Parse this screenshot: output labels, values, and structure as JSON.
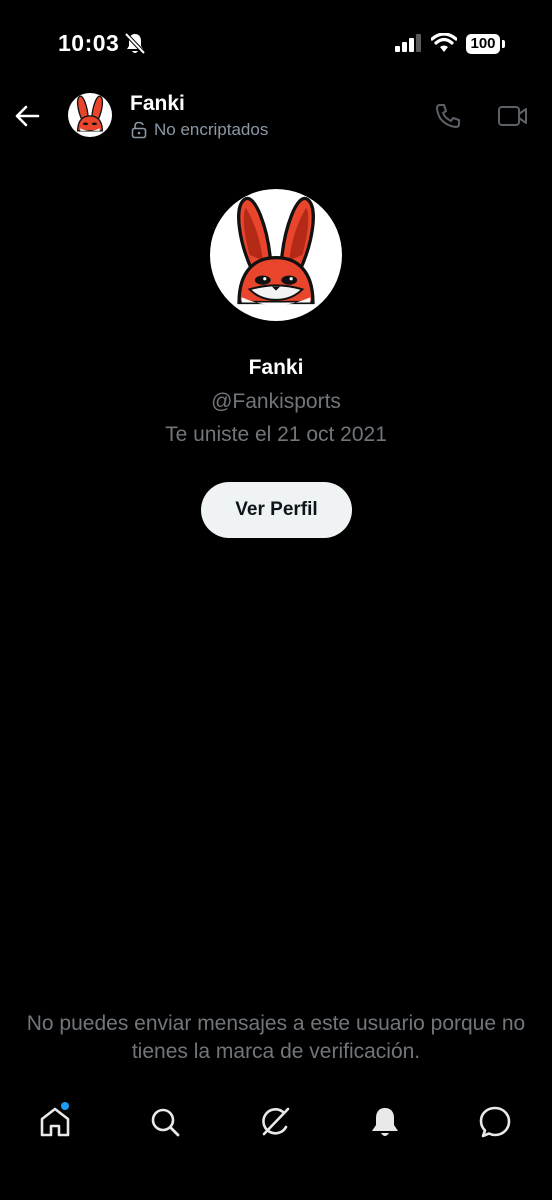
{
  "status_bar": {
    "time": "10:03",
    "battery": "100"
  },
  "header": {
    "contact_name": "Fanki",
    "encryption_status": "No encriptados"
  },
  "profile": {
    "name": "Fanki",
    "handle": "@Fankisports",
    "joined": "Te uniste el 21 oct 2021",
    "view_profile_label": "Ver Perfil"
  },
  "notice": {
    "text": "No puedes enviar mensajes a este usuario porque no tienes la marca de verificación."
  },
  "bottom_nav": {
    "items": [
      "home-icon",
      "search-icon",
      "grok-icon",
      "notifications-icon",
      "messages-icon"
    ],
    "home_has_badge": true
  },
  "colors": {
    "background": "#000000",
    "accent": "#1d9bf0",
    "muted_text": "#71767b",
    "button_bg": "#eff3f4",
    "avatar_red": "#e8452c"
  }
}
